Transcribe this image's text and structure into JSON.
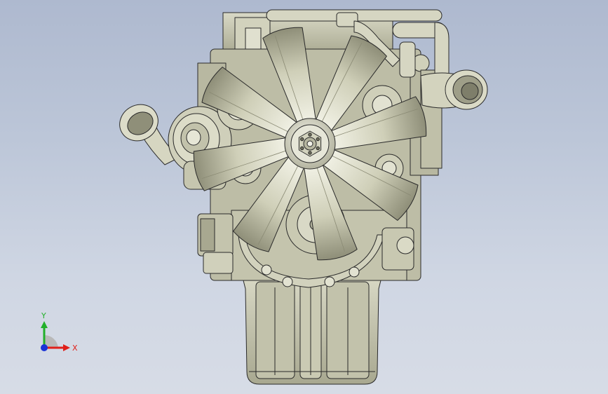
{
  "viewport": {
    "background_top": "#aeb9cf",
    "background_bottom": "#d7dce6",
    "model_fill": "#c9c9b4",
    "model_edge": "#2a2a2a",
    "fan_blade_count": 8
  },
  "triad": {
    "x_label": "X",
    "y_label": "Y",
    "x_color": "#e0201a",
    "y_color": "#22b02a",
    "z_color": "#1a33d6",
    "icon": "coordinate-triad-icon"
  }
}
